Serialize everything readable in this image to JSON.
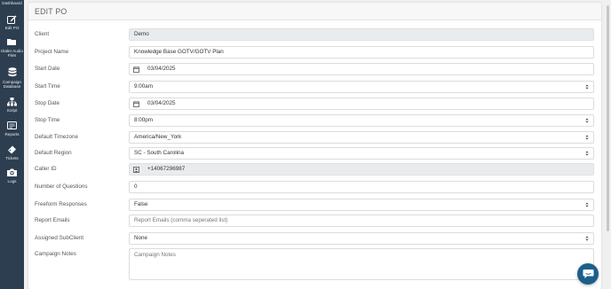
{
  "sidebar": {
    "items": [
      {
        "label": "Dashboard",
        "icon": "dashboard-icon"
      },
      {
        "label": "Edit PO",
        "icon": "edit-icon"
      },
      {
        "label": "Dialer Audio Files",
        "icon": "folder-icon"
      },
      {
        "label": "Campaign Database",
        "icon": "database-icon"
      },
      {
        "label": "Script",
        "icon": "sitemap-icon"
      },
      {
        "label": "Reports",
        "icon": "reports-icon"
      },
      {
        "label": "Tickets",
        "icon": "ticket-icon"
      },
      {
        "label": "Logs",
        "icon": "camera-icon"
      }
    ]
  },
  "page": {
    "title": "EDIT PO"
  },
  "form": {
    "client": {
      "label": "Client",
      "value": "Demo"
    },
    "project_name": {
      "label": "Project Name",
      "value": "Knowledge Base GOTV/GOTV Plan"
    },
    "start_date": {
      "label": "Start Date",
      "value": "03/04/2025"
    },
    "start_time": {
      "label": "Start Time",
      "value": "9:00am"
    },
    "stop_date": {
      "label": "Stop Date",
      "value": "03/04/2025"
    },
    "stop_time": {
      "label": "Stop Time",
      "value": "8:00pm"
    },
    "default_timezone": {
      "label": "Default Timezone",
      "value": "America/New_York"
    },
    "default_region": {
      "label": "Default Region",
      "value": "SC - South Carolina"
    },
    "caller_id": {
      "label": "Caller ID",
      "value": "+14067296987"
    },
    "number_of_questions": {
      "label": "Number of Questions",
      "value": "0"
    },
    "freeform_responses": {
      "label": "Freeform Responses",
      "value": "False"
    },
    "report_emails": {
      "label": "Report Emails",
      "placeholder": "Report Emails (comma seperated list)"
    },
    "assigned_subclient": {
      "label": "Assigned SubClient",
      "value": "None"
    },
    "campaign_notes": {
      "label": "Campaign Notes",
      "placeholder": "Campaign Notes"
    }
  },
  "colors": {
    "sidebar_bg": "#2d3e50",
    "chat_button": "#1c5f8c"
  },
  "chat": {
    "icon": "chat-bubble-icon"
  }
}
